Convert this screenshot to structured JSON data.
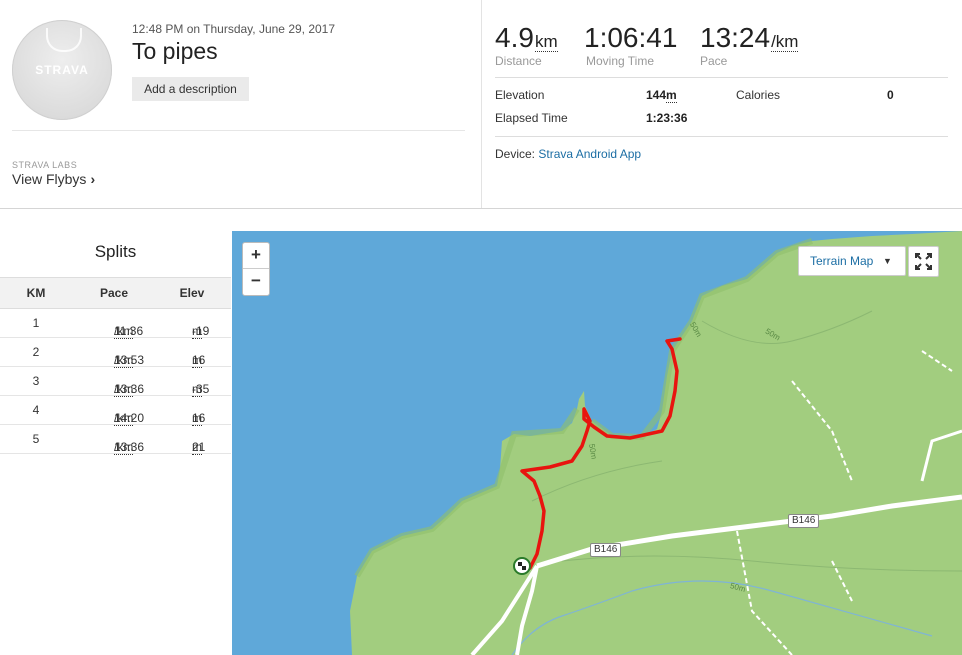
{
  "header": {
    "avatar_text": "STRAVA",
    "datetime": "12:48 PM on Thursday, June 29, 2017",
    "title": "To pipes",
    "add_description_label": "Add a description",
    "labs_label": "STRAVA LABS",
    "flybys_label": "View Flybys",
    "flybys_chevron": "›"
  },
  "stats": {
    "distance": {
      "value": "4.9",
      "unit": "km",
      "label": "Distance"
    },
    "moving_time": {
      "value": "1:06:41",
      "label": "Moving Time"
    },
    "pace": {
      "value": "13:24",
      "unit": "/km",
      "label": "Pace"
    },
    "elevation": {
      "label": "Elevation",
      "value": "144",
      "unit": "m"
    },
    "calories": {
      "label": "Calories",
      "value": "0"
    },
    "elapsed": {
      "label": "Elapsed Time",
      "value": "1:23:36"
    },
    "device_label": "Device:",
    "device_value": "Strava Android App"
  },
  "splits": {
    "title": "Splits",
    "headers": [
      "KM",
      "Pace",
      "Elev"
    ],
    "pace_unit": "/km",
    "elev_unit": "m",
    "rows": [
      {
        "km": "1",
        "pace": "11:36",
        "elev": "-19"
      },
      {
        "km": "2",
        "pace": "13:53",
        "elev": "16"
      },
      {
        "km": "3",
        "pace": "13:36",
        "elev": "-35"
      },
      {
        "km": "4",
        "pace": "14:20",
        "elev": "16"
      },
      {
        "km": "5",
        "pace": "13:36",
        "elev": "21"
      }
    ]
  },
  "map": {
    "zoom_in": "+",
    "zoom_out": "−",
    "map_type_label": "Terrain Map",
    "map_type_caret": "▼",
    "road_label_1": "B146",
    "road_label_2": "B146",
    "contour_label_1": "50m",
    "contour_label_2": "50m",
    "contour_label_3": "50m",
    "contour_label_4": "50m",
    "colors": {
      "sea": "#5fa8d9",
      "land": "#a2cd7f",
      "route": "#e8140f"
    },
    "icons": [
      "zoom-in-icon",
      "zoom-out-icon",
      "fullscreen-icon",
      "finish-flag-icon"
    ]
  }
}
